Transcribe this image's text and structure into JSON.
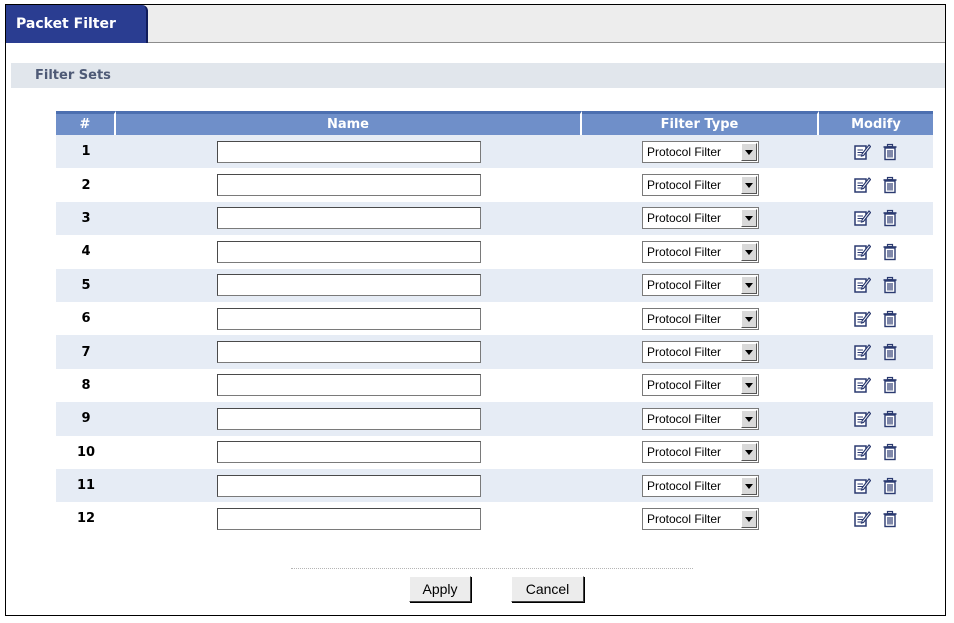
{
  "tab": {
    "label": "Packet Filter"
  },
  "section": {
    "title": "Filter Sets"
  },
  "table": {
    "headers": {
      "num": "#",
      "name": "Name",
      "type": "Filter Type",
      "modify": "Modify"
    },
    "rows": [
      {
        "num": "1",
        "name": "",
        "type": "Protocol Filter"
      },
      {
        "num": "2",
        "name": "",
        "type": "Protocol Filter"
      },
      {
        "num": "3",
        "name": "",
        "type": "Protocol Filter"
      },
      {
        "num": "4",
        "name": "",
        "type": "Protocol Filter"
      },
      {
        "num": "5",
        "name": "",
        "type": "Protocol Filter"
      },
      {
        "num": "6",
        "name": "",
        "type": "Protocol Filter"
      },
      {
        "num": "7",
        "name": "",
        "type": "Protocol Filter"
      },
      {
        "num": "8",
        "name": "",
        "type": "Protocol Filter"
      },
      {
        "num": "9",
        "name": "",
        "type": "Protocol Filter"
      },
      {
        "num": "10",
        "name": "",
        "type": "Protocol Filter"
      },
      {
        "num": "11",
        "name": "",
        "type": "Protocol Filter"
      },
      {
        "num": "12",
        "name": "",
        "type": "Protocol Filter"
      }
    ]
  },
  "buttons": {
    "apply": "Apply",
    "cancel": "Cancel"
  },
  "icons": {
    "edit": "edit-icon",
    "delete": "trash-icon"
  },
  "colors": {
    "tab": "#2a3d91",
    "header": "#6f8fc9",
    "section": "#e1e6ec",
    "stripe": "#e6ecf5"
  }
}
